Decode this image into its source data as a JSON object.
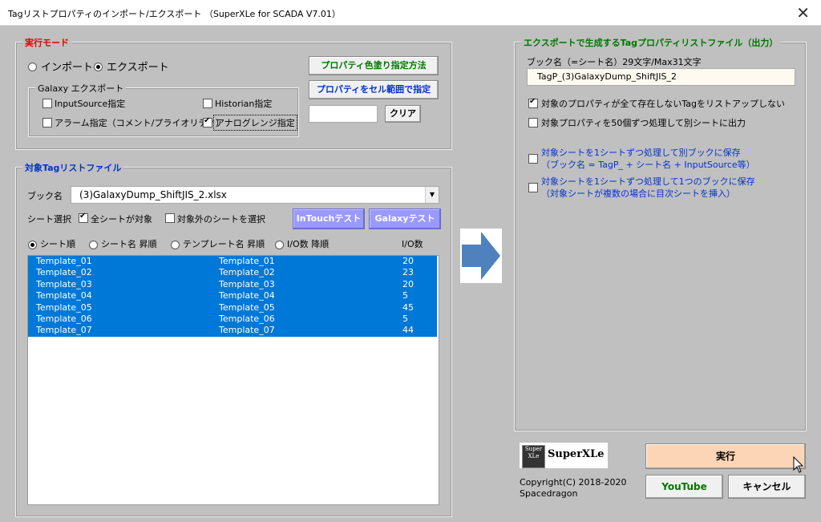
{
  "title": "Tagリストプロパティのインポート/エクスポート （SuperXLe for SCADA V7.01）",
  "mode": {
    "title": "実行モード",
    "import_label": "インポート",
    "export_label": "エクスポート",
    "selected": "export",
    "color_btn": "プロパティ色塗り指定方法",
    "range_btn": "プロパティをセル範囲で指定",
    "clear_btn": "クリア",
    "clear_value": "",
    "galaxy_title": "Galaxy エクスポート",
    "galaxy_options": [
      {
        "label": "InputSource指定",
        "checked": false
      },
      {
        "label": "Historian指定",
        "checked": false
      },
      {
        "label": "アラーム指定（コメント/プライオリティ）",
        "checked": false
      },
      {
        "label": "アナログレンジ指定",
        "checked": true
      }
    ]
  },
  "target": {
    "title": "対象Tagリストファイル",
    "book_label": "ブック名",
    "book_value": "(3)GalaxyDump_ShiftJIS_2.xlsx",
    "sheet_select_label": "シート選択",
    "all_sheets_label": "全シートが対象",
    "all_sheets_checked": true,
    "other_sheets_label": "対象外のシートを選択",
    "other_sheets_checked": false,
    "intouch_btn": "InTouchテスト",
    "galaxy_btn": "Galaxyテスト",
    "sort_options": [
      "シート順",
      "シート名 昇順",
      "テンプレート名 昇順",
      "I/O数 降順"
    ],
    "sort_selected": 0,
    "io_header": "I/O数",
    "rows": [
      {
        "sheet": "Template_01",
        "template": "Template_01",
        "io": "20"
      },
      {
        "sheet": "Template_02",
        "template": "Template_02",
        "io": "23"
      },
      {
        "sheet": "Template_03",
        "template": "Template_03",
        "io": "20"
      },
      {
        "sheet": "Template_04",
        "template": "Template_04",
        "io": "5"
      },
      {
        "sheet": "Template_05",
        "template": "Template_05",
        "io": "45"
      },
      {
        "sheet": "Template_06",
        "template": "Template_06",
        "io": "5"
      },
      {
        "sheet": "Template_07",
        "template": "Template_07",
        "io": "44"
      }
    ]
  },
  "export": {
    "title": "エクスポートで生成するTagプロパティリストファイル（出力）",
    "book_label": "ブック名（=シート名）29文字/Max31文字",
    "book_value": "TagP_(3)GalaxyDump_ShiftJIS_2",
    "opt1": "対象のプロパティが全て存在しないTagをリストアップしない",
    "opt1_checked": true,
    "opt2": "対象プロパティを50個ずつ処理して別シートに出力",
    "opt2_checked": false,
    "opt3_line1": "対象シートを1シートずつ処理して別ブックに保存",
    "opt3_line2": "（ブック名 = TagP_ + シート名 + InputSource等）",
    "opt3_checked": false,
    "opt4_line1": "対象シートを1シートずつ処理して1つのブックに保存",
    "opt4_line2": "（対象シートが複数の場合に目次シートを挿入）",
    "opt4_checked": false
  },
  "footer": {
    "logo_text": "SuperXLe",
    "logo_icon_text": "Super XLe",
    "copyright": "Copyright(C) 2018-2020",
    "author": "Spacedragon",
    "run_btn": "実行",
    "youtube_btn": "YouTube",
    "cancel_btn": "キャンセル"
  },
  "colors": {
    "dialog_bg": "#c0c0c0",
    "selection": "#0078d7",
    "arrow": "#4f81bd",
    "run_bg": "#fbd5b5",
    "lavender": "#9999ff"
  }
}
